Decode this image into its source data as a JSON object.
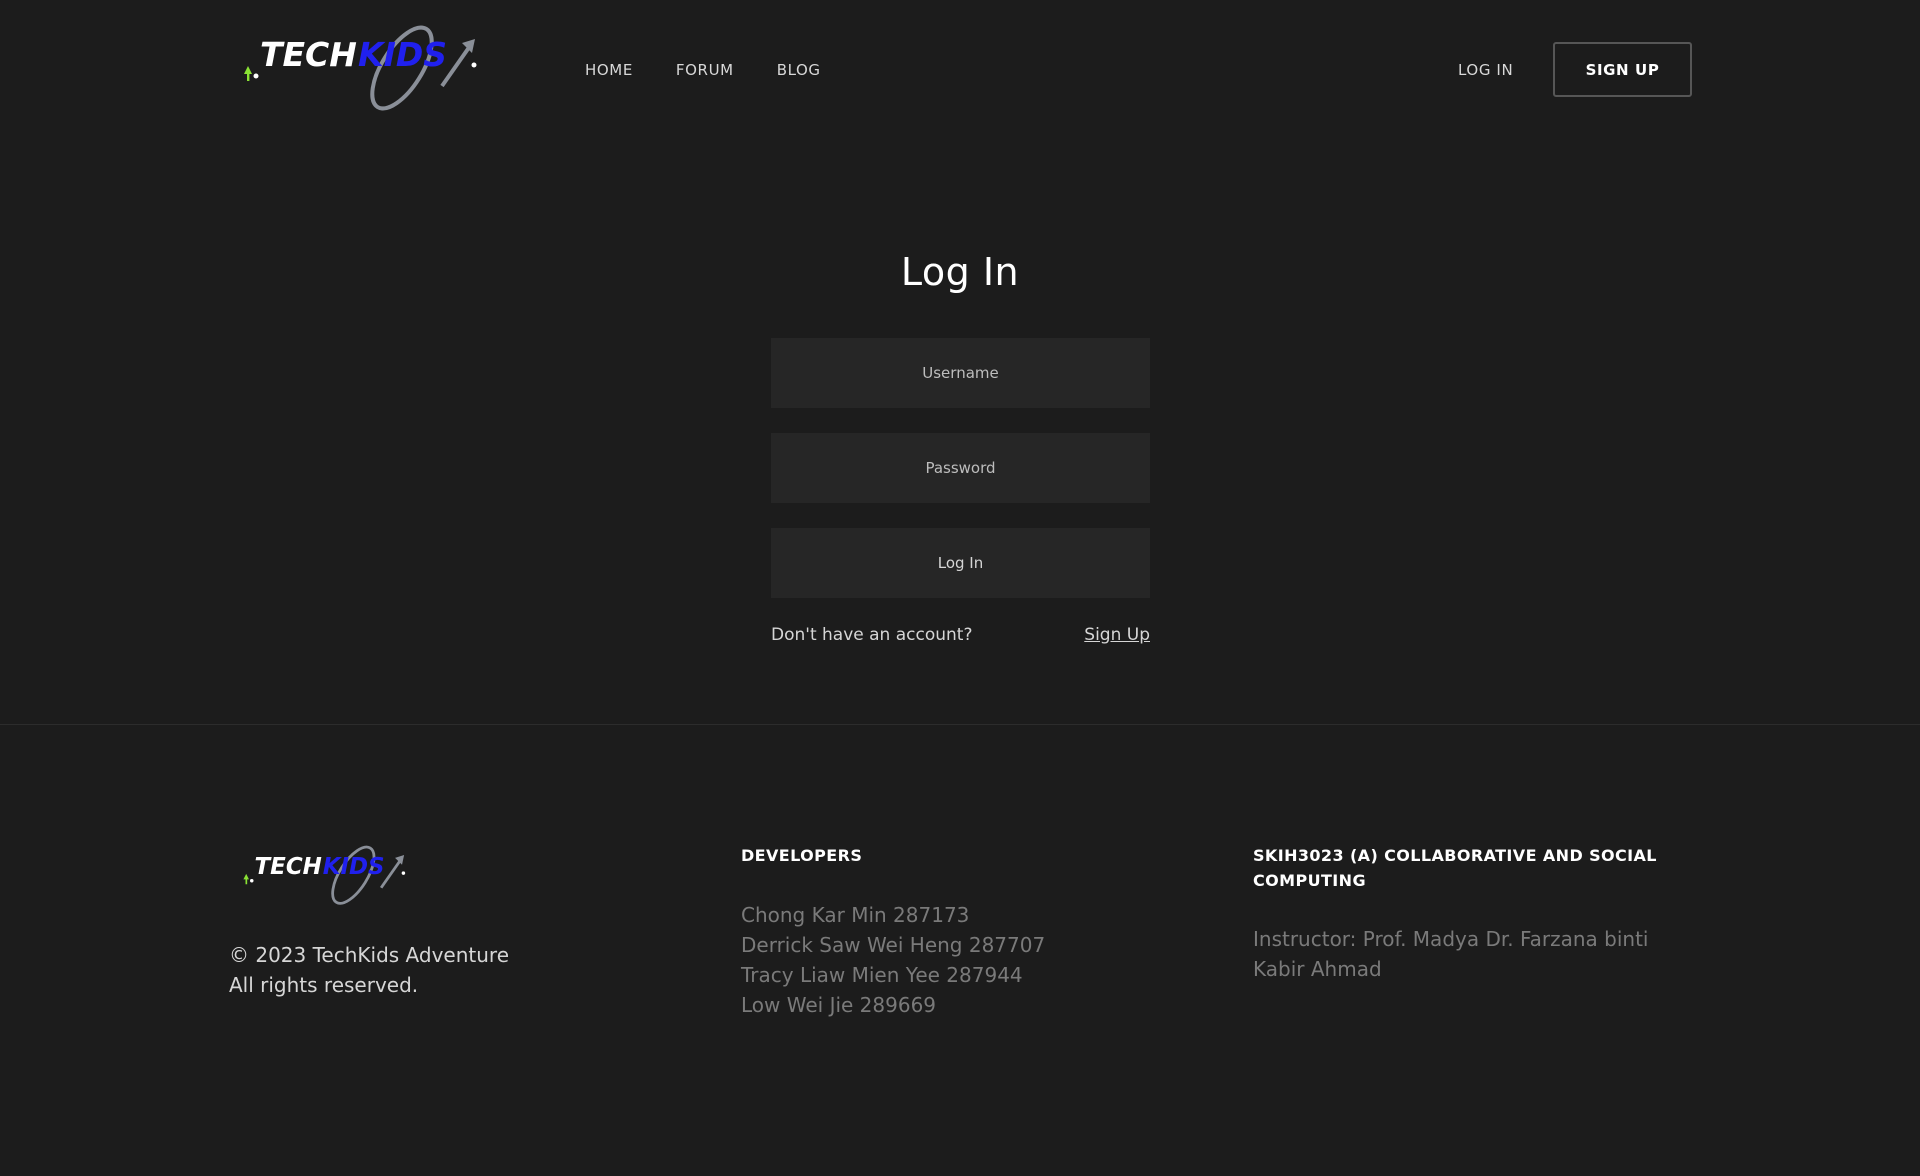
{
  "brand": {
    "logo_text_a": "TECH",
    "logo_text_b": "KIDS",
    "colors": {
      "white": "#ffffff",
      "blue": "#2020ee",
      "green": "#8ae234",
      "swoosh": "#8a8f98"
    }
  },
  "header": {
    "nav": [
      "HOME",
      "FORUM",
      "BLOG"
    ],
    "login_label": "LOG IN",
    "signup_label": "SIGN UP"
  },
  "login_form": {
    "title": "Log In",
    "username_placeholder": "Username",
    "password_placeholder": "Password",
    "submit_label": "Log In",
    "no_account_text": "Don't have an account?",
    "signup_link": "Sign Up"
  },
  "footer": {
    "copyright_line1": "© 2023 TechKids Adventure",
    "copyright_line2": "All rights reserved.",
    "developers_heading": "DEVELOPERS",
    "developers": [
      "Chong Kar Min 287173",
      "Derrick Saw Wei Heng 287707",
      "Tracy Liaw Mien Yee 287944",
      "Low Wei Jie 289669"
    ],
    "course_heading": "SKIH3023 (A) COLLABORATIVE AND SOCIAL COMPUTING",
    "instructor": "Instructor: Prof. Madya Dr. Farzana binti Kabir Ahmad"
  }
}
